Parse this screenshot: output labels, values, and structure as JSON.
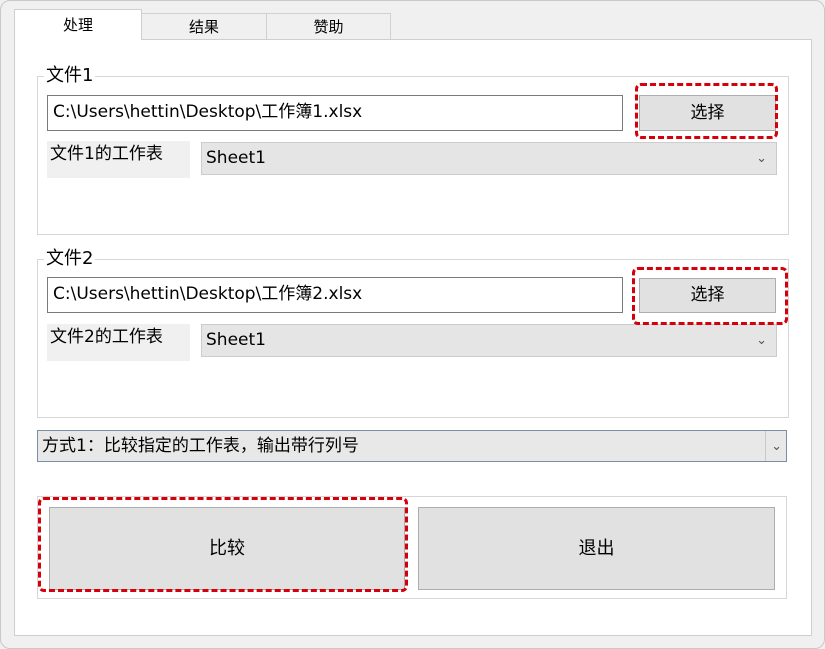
{
  "tabs": [
    {
      "label": "处理",
      "active": true
    },
    {
      "label": "结果",
      "active": false
    },
    {
      "label": "赞助",
      "active": false
    }
  ],
  "file1": {
    "legend": "文件1",
    "path": "C:\\Users\\hettin\\Desktop\\工作簿1.xlsx",
    "select_button": "选择",
    "sheet_label": "文件1的工作表",
    "sheet_value": "Sheet1"
  },
  "file2": {
    "legend": "文件2",
    "path": "C:\\Users\\hettin\\Desktop\\工作簿2.xlsx",
    "select_button": "选择",
    "sheet_label": "文件2的工作表",
    "sheet_value": "Sheet1"
  },
  "mode": {
    "selected": "方式1：比较指定的工作表，输出带行列号"
  },
  "actions": {
    "compare_button": "比较",
    "exit_button": "退出"
  },
  "icons": {
    "dropdown": "chevron-down-icon"
  },
  "colors": {
    "highlight": "#d6000a",
    "button_bg": "#e1e1e1",
    "window_bg": "#f0f0f0"
  }
}
